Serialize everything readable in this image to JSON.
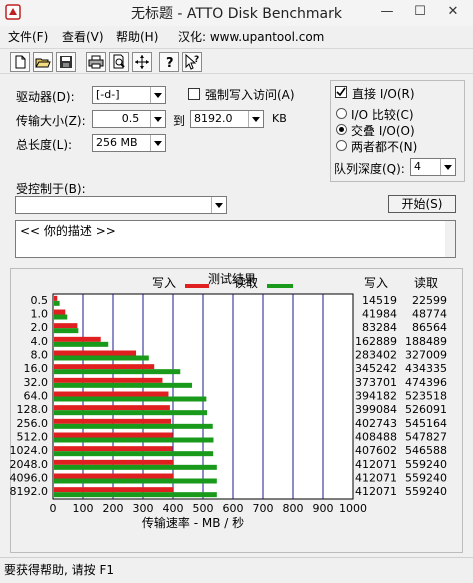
{
  "window": {
    "title": "无标题 - ATTO Disk Benchmark",
    "minimize": "—",
    "maximize": "☐",
    "close": "✕"
  },
  "menu": [
    "文件(F)",
    "查看(V)",
    "帮助(H)",
    "汉化: www.upantool.com"
  ],
  "form": {
    "drive_label": "驱动器(D):",
    "drive_value": "[-d-]",
    "force_write_label": "强制写入访问(A)",
    "transfer_label": "传输大小(Z):",
    "transfer_from": "0.5",
    "to_label": "到",
    "transfer_to": "8192.0",
    "transfer_unit": "KB",
    "length_label": "总长度(L):",
    "length_value": "256 MB",
    "direct_io_label": "直接 I/O(R)",
    "io_compare_label": "I/O 比较(C)",
    "overlap_io_label": "交叠 I/O(O)",
    "neither_label": "两者都不(N)",
    "queue_label": "队列深度(Q):",
    "queue_value": "4",
    "controlled_label": "受控制于(B):",
    "controlled_value": "",
    "start_label": "开始(S)",
    "description": "<<  你的描述  >>"
  },
  "results": {
    "header": "测试结果",
    "write_label": "写入",
    "read_label": "读取",
    "col_write": "写入",
    "col_read": "读取"
  },
  "chart_data": {
    "type": "bar",
    "orientation": "horizontal",
    "xlabel": "传输速率 - MB / 秒",
    "xlim": [
      0,
      1000
    ],
    "x_ticks": [
      0,
      100,
      200,
      300,
      400,
      500,
      600,
      700,
      800,
      900,
      1000
    ],
    "categories": [
      "0.5",
      "1.0",
      "2.0",
      "4.0",
      "8.0",
      "16.0",
      "32.0",
      "64.0",
      "128.0",
      "256.0",
      "512.0",
      "1024.0",
      "2048.0",
      "4096.0",
      "8192.0"
    ],
    "series": [
      {
        "name": "写入",
        "color": "#e02020",
        "values": [
          14.2,
          41.0,
          81.3,
          159.1,
          276.8,
          337.4,
          364.9,
          385.0,
          389.7,
          393.3,
          399.0,
          398.1,
          402.4,
          402.4,
          402.4
        ]
      },
      {
        "name": "读取",
        "color": "#1a9a1a",
        "values": [
          22.1,
          47.6,
          84.5,
          184.1,
          319.4,
          424.2,
          463.4,
          511.2,
          513.7,
          532.4,
          534.9,
          533.8,
          546.1,
          546.1,
          546.1
        ]
      }
    ],
    "write_kb": [
      14519,
      41984,
      83284,
      162889,
      283402,
      345242,
      373701,
      394182,
      399084,
      402743,
      408488,
      407602,
      412071,
      412071,
      412071
    ],
    "read_kb": [
      22599,
      48774,
      86564,
      188489,
      327009,
      434335,
      474396,
      523518,
      526091,
      545164,
      547827,
      546588,
      559240,
      559240,
      559240
    ],
    "legend": "top",
    "grid": true
  },
  "status": "要获得帮助, 请按 F1"
}
